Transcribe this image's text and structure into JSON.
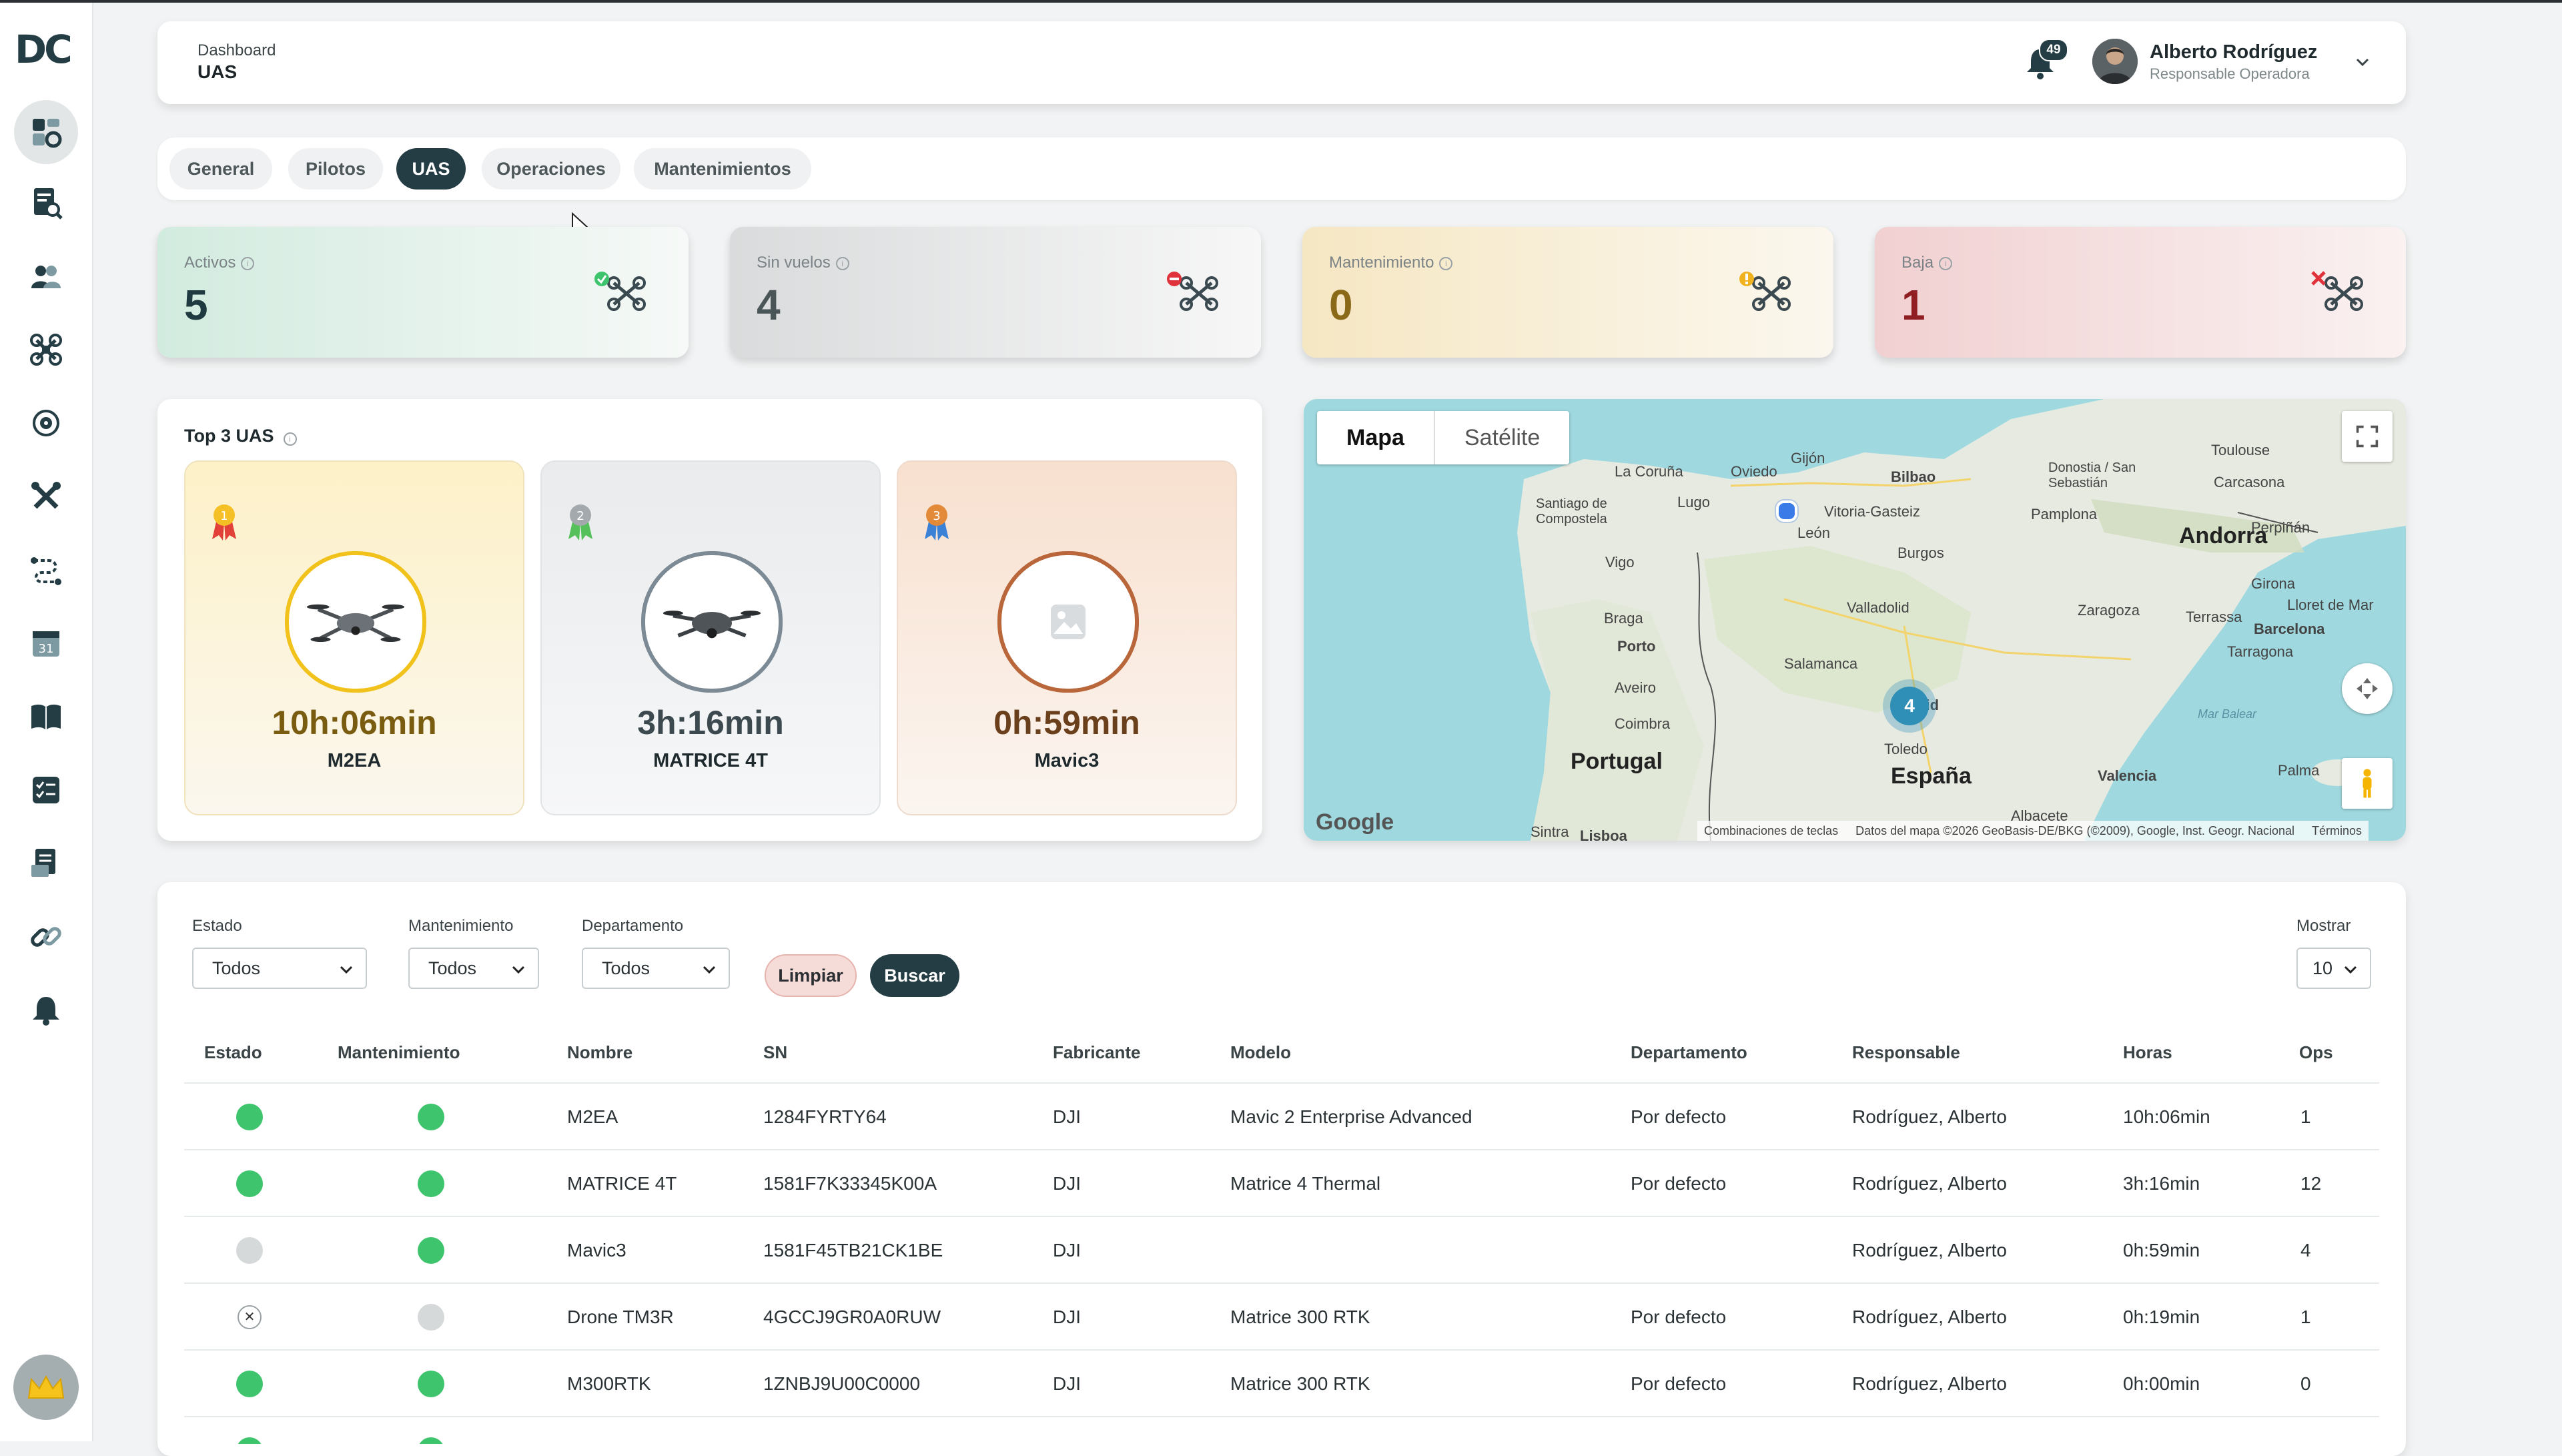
{
  "header": {
    "breadcrumb_parent": "Dashboard",
    "breadcrumb_current": "UAS",
    "notifications": "49",
    "user_name": "Alberto Rodríguez",
    "user_role": "Responsable Operadora"
  },
  "tabs": [
    "General",
    "Pilotos",
    "UAS",
    "Operaciones",
    "Mantenimientos"
  ],
  "active_tab": "UAS",
  "stats": [
    {
      "label": "Activos",
      "value": "5",
      "color": "#1f3a40"
    },
    {
      "label": "Sin vuelos",
      "value": "4",
      "color": "#4a5558"
    },
    {
      "label": "Mantenimiento",
      "value": "0",
      "color": "#8a6a18"
    },
    {
      "label": "Baja",
      "value": "1",
      "color": "#8f1f22"
    }
  ],
  "top3": {
    "title": "Top 3 UAS",
    "items": [
      {
        "rank": "1",
        "hours": "10h:06min",
        "name": "M2EA",
        "hours_color": "#7a5c10"
      },
      {
        "rank": "2",
        "hours": "3h:16min",
        "name": "MATRICE 4T",
        "hours_color": "#3c4a50"
      },
      {
        "rank": "3",
        "hours": "0h:59min",
        "name": "Mavic3",
        "hours_color": "#6a3f1c"
      }
    ]
  },
  "map": {
    "tab_map": "Mapa",
    "tab_satellite": "Satélite",
    "cluster_count": "4",
    "labels": [
      "Toulouse",
      "Gijón",
      "La Coruña",
      "Oviedo",
      "Bilbao",
      "Donostia / San Sebastián",
      "Carcasona",
      "Santiago de Compostela",
      "Lugo",
      "Vitoria-Gasteiz",
      "Pamplona",
      "Andorra",
      "Perpiñán",
      "León",
      "Burgos",
      "Girona",
      "Vigo",
      "Braga",
      "Valladolid",
      "Zaragoza",
      "Terrassa",
      "Lloret de Mar",
      "Barcelona",
      "Porto",
      "Tarragona",
      "Salamanca",
      "Aveiro",
      "Coimbra",
      "Madrid",
      "Toledo",
      "Portugal",
      "España",
      "Valencia",
      "Palma",
      "Albacete",
      "Sintra",
      "Lisboa",
      "Mar Balear"
    ],
    "footer": [
      "Combinaciones de teclas",
      "Datos del mapa ©2026 GeoBasis-DE/BKG (©2009), Google, Inst. Geogr. Nacional",
      "Términos"
    ],
    "google": "Google"
  },
  "filters": {
    "estado_label": "Estado",
    "estado_value": "Todos",
    "mant_label": "Mantenimiento",
    "mant_value": "Todos",
    "depto_label": "Departamento",
    "depto_value": "Todos",
    "clear": "Limpiar",
    "search": "Buscar",
    "show_label": "Mostrar",
    "show_value": "10"
  },
  "table": {
    "headers": [
      "Estado",
      "Mantenimiento",
      "Nombre",
      "SN",
      "Fabricante",
      "Modelo",
      "Departamento",
      "Responsable",
      "Horas",
      "Ops"
    ],
    "rows": [
      {
        "estado": "green",
        "mant": "green",
        "nombre": "M2EA",
        "sn": "1284FYRTY64",
        "fab": "DJI",
        "modelo": "Mavic 2 Enterprise Advanced",
        "depto": "Por defecto",
        "resp": "Rodríguez, Alberto",
        "horas": "10h:06min",
        "ops": "1"
      },
      {
        "estado": "green",
        "mant": "green",
        "nombre": "MATRICE 4T",
        "sn": "1581F7K33345K00A",
        "fab": "DJI",
        "modelo": "Matrice 4 Thermal",
        "depto": "Por defecto",
        "resp": "Rodríguez, Alberto",
        "horas": "3h:16min",
        "ops": "12"
      },
      {
        "estado": "grey",
        "mant": "green",
        "nombre": "Mavic3",
        "sn": "1581F45TB21CK1BE",
        "fab": "DJI",
        "modelo": "",
        "depto": "",
        "resp": "Rodríguez, Alberto",
        "horas": "0h:59min",
        "ops": "4"
      },
      {
        "estado": "x",
        "mant": "grey",
        "nombre": "Drone TM3R",
        "sn": "4GCCJ9GR0A0RUW",
        "fab": "DJI",
        "modelo": "Matrice 300 RTK",
        "depto": "Por defecto",
        "resp": "Rodríguez, Alberto",
        "horas": "0h:19min",
        "ops": "1"
      },
      {
        "estado": "green",
        "mant": "green",
        "nombre": "M300RTK",
        "sn": "1ZNBJ9U00C0000",
        "fab": "DJI",
        "modelo": "Matrice 300 RTK",
        "depto": "Por defecto",
        "resp": "Rodríguez, Alberto",
        "horas": "0h:00min",
        "ops": "0"
      }
    ]
  },
  "colors": {
    "brand": "#243c43",
    "status_green": "#3ec46d"
  }
}
